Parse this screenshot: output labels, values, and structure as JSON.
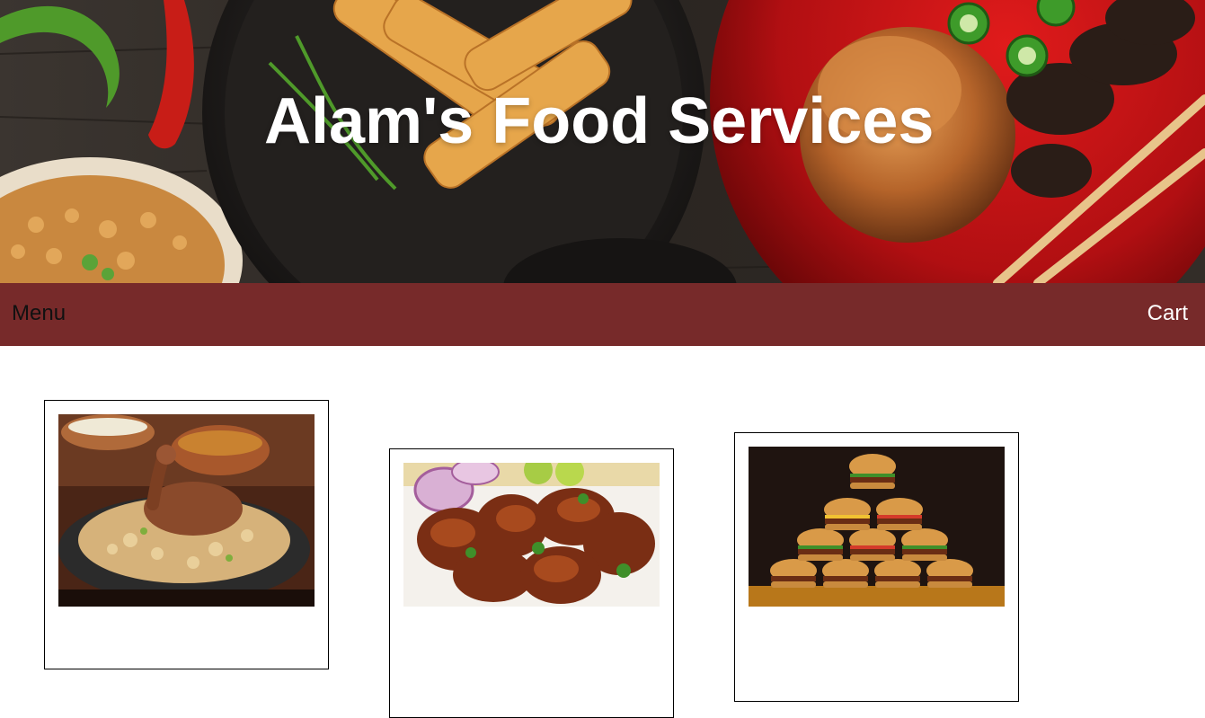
{
  "header": {
    "title": "Alam's Food Services",
    "banner_image": "food-platters-banner"
  },
  "nav": {
    "menu_label": "Menu",
    "cart_label": "Cart",
    "bar_color": "#772a2a"
  },
  "products": [
    {
      "image": "chicken-biryani-photo"
    },
    {
      "image": "fried-chicken-pieces-photo"
    },
    {
      "image": "burger-pyramid-photo"
    }
  ]
}
